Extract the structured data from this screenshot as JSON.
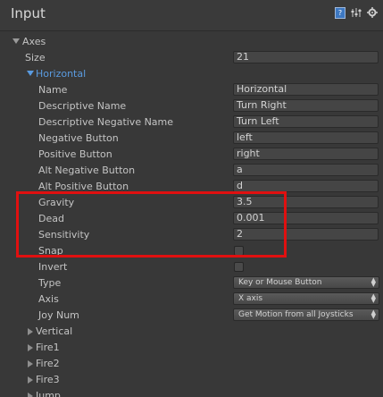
{
  "window": {
    "title": "Input"
  },
  "header_icons": [
    "help-book-icon",
    "preset-sliders-icon",
    "settings-gear-icon"
  ],
  "axes": {
    "label": "Axes",
    "size_label": "Size",
    "size_value": "21",
    "horizontal": {
      "label": "Horizontal",
      "fields": {
        "name": {
          "label": "Name",
          "value": "Horizontal"
        },
        "descriptive_name": {
          "label": "Descriptive Name",
          "value": "Turn Right"
        },
        "descriptive_negative_name": {
          "label": "Descriptive Negative Name",
          "value": "Turn Left"
        },
        "negative_button": {
          "label": "Negative Button",
          "value": "left"
        },
        "positive_button": {
          "label": "Positive Button",
          "value": "right"
        },
        "alt_negative_button": {
          "label": "Alt Negative Button",
          "value": "a"
        },
        "alt_positive_button": {
          "label": "Alt Positive Button",
          "value": "d"
        },
        "gravity": {
          "label": "Gravity",
          "value": "3.5"
        },
        "dead": {
          "label": "Dead",
          "value": "0.001"
        },
        "sensitivity": {
          "label": "Sensitivity",
          "value": "2"
        },
        "snap": {
          "label": "Snap",
          "checked": false
        },
        "invert": {
          "label": "Invert",
          "checked": false
        },
        "type": {
          "label": "Type",
          "value": "Key or Mouse Button"
        },
        "axis": {
          "label": "Axis",
          "value": "X axis"
        },
        "joy_num": {
          "label": "Joy Num",
          "value": "Get Motion from all Joysticks"
        }
      }
    },
    "collapsed": [
      "Vertical",
      "Fire1",
      "Fire2",
      "Fire3",
      "Jump"
    ]
  },
  "colors": {
    "background": "#383838",
    "highlight_box": "#e01010",
    "selected_item": "#5a9be0"
  }
}
